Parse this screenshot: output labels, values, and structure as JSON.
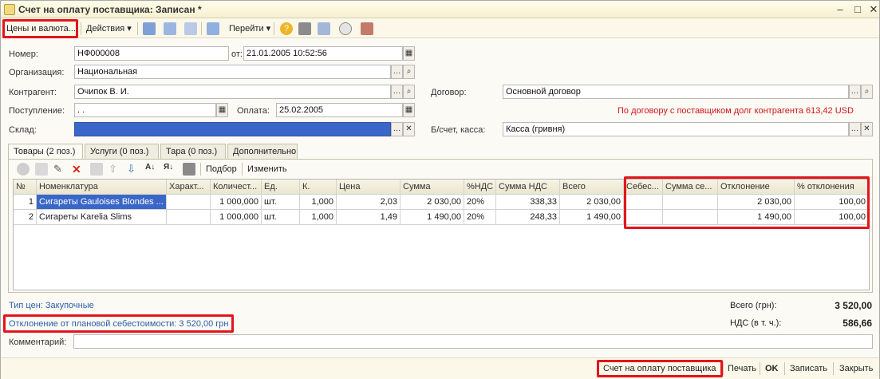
{
  "window": {
    "title": "Счет на оплату поставщика: Записан *"
  },
  "toolbar": {
    "prices": "Цены и валюта...",
    "actions": "Действия",
    "goto": "Перейти"
  },
  "form": {
    "number_label": "Номер:",
    "number": "НФ000008",
    "date_label": "от:",
    "date": "21.01.2005 10:52:56",
    "org_label": "Организация:",
    "org": "Национальная",
    "contractor_label": "Контрагент:",
    "contractor": "Очипок В. И.",
    "contract_label": "Договор:",
    "contract": "Основной договор",
    "receipt_label": "Поступление:",
    "receipt": " .  .",
    "payment_label": "Оплата:",
    "payment": "25.02.2005",
    "debt_info": "По договору с поставщиком долг контрагента 613,42 USD",
    "warehouse_label": "Склад:",
    "warehouse": "",
    "account_label": "Б/счет, касса:",
    "account": "Касса (гривня)"
  },
  "tabs": [
    {
      "label": "Товары (2 поз.)"
    },
    {
      "label": "Услуги (0 поз.)"
    },
    {
      "label": "Тара (0 поз.)"
    },
    {
      "label": "Дополнительно"
    }
  ],
  "grid_toolbar": {
    "select": "Подбор",
    "change": "Изменить"
  },
  "table": {
    "headers": [
      "№",
      "Номенклатура",
      "Характ...",
      "Количест...",
      "Ед.",
      "К.",
      "Цена",
      "Сумма",
      "%НДС",
      "Сумма НДС",
      "Всего",
      "Себес...",
      "Сумма се...",
      "Отклонение",
      "% отклонения"
    ],
    "rows": [
      [
        "1",
        "Сигареты Gauloises Blondes ...",
        "",
        "1 000,000",
        "шт.",
        "1,000",
        "2,03",
        "2 030,00",
        "20%",
        "338,33",
        "2 030,00",
        "",
        "",
        "2 030,00",
        "100,00"
      ],
      [
        "2",
        "Сигареты Karelia Slims",
        "",
        "1 000,000",
        "шт.",
        "1,000",
        "1,49",
        "1 490,00",
        "20%",
        "248,33",
        "1 490,00",
        "",
        "",
        "1 490,00",
        "100,00"
      ]
    ]
  },
  "footer": {
    "price_type": "Тип цен: Закупочные",
    "deviation": "Отклонение от плановой себестоимости: 3 520,00 грн",
    "total_label": "Всего (грн):",
    "total": "3 520,00",
    "vat_label": "НДС (в т. ч.):",
    "vat": "586,66",
    "comment_label": "Комментарий:",
    "comment": ""
  },
  "bottom": {
    "print_form": "Счет на оплату поставщика",
    "print": "Печать",
    "ok": "OK",
    "save": "Записать",
    "close": "Закрыть"
  },
  "colors": {
    "highlight": "#e3141b",
    "selection": "#3a67c7",
    "link": "#2a5ea8",
    "warning": "#d0161a"
  }
}
